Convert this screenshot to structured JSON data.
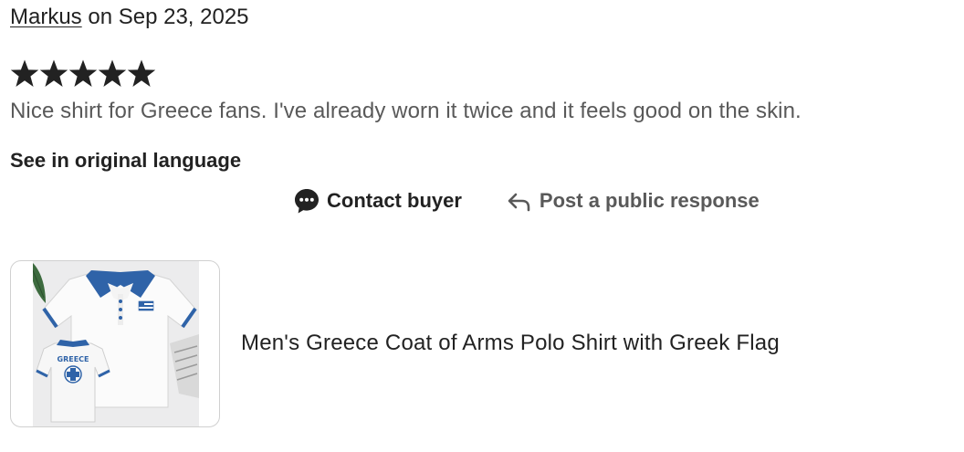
{
  "review": {
    "reviewer_name": "Markus",
    "date_text": " on Sep 23, 2025",
    "rating": 5,
    "rating_max": 5,
    "text": "Nice shirt for Greece fans. I've already worn it twice and it feels good on the skin.",
    "original_language_link": "See in original language"
  },
  "actions": {
    "contact_buyer": "Contact buyer",
    "post_public_response": "Post a public response"
  },
  "product": {
    "title": "Men's Greece Coat of Arms Polo Shirt with Greek Flag",
    "image_text": "GREECE"
  },
  "colors": {
    "text_primary": "#222222",
    "text_secondary": "#595959",
    "star": "#222222",
    "shirt_blue": "#2f63a8"
  },
  "icons": {
    "star": "star-icon",
    "contact": "chat-bubble-icon",
    "reply": "reply-arrow-icon"
  }
}
